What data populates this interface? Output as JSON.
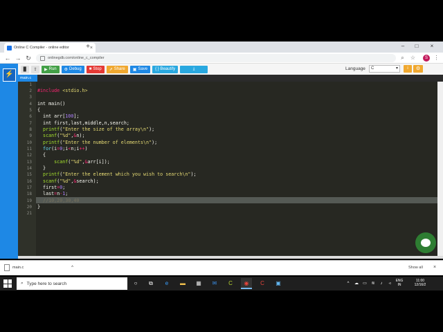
{
  "browser": {
    "tab_title": "Online C Compiler - online editor",
    "url": "onlinegdb.com/online_c_compiler",
    "profile_initial": "S"
  },
  "toolbar": {
    "run_label": "Run",
    "debug_label": "Debug",
    "stop_label": "Stop",
    "share_label": "Share",
    "save_label": "Save",
    "beautify_label": "{ } Beautify",
    "language_label": "Language",
    "language_value": "C"
  },
  "editor": {
    "file_tab": "main.c",
    "line_numbers": [
      "1",
      "2",
      "3",
      "4",
      "5",
      "6",
      "7",
      "8",
      "9",
      "10",
      "11",
      "12",
      "13",
      "14",
      "15",
      "16",
      "17",
      "18",
      "19",
      "20",
      "21"
    ]
  },
  "downloads": {
    "file_name": "main.c",
    "show_all": "Show all"
  },
  "taskbar": {
    "search_placeholder": "Type here to search",
    "language_line1": "ENG",
    "language_line2": "IN",
    "time": "11:00",
    "date": "12/16/2"
  },
  "colors": {
    "accent": "#1e88e5",
    "run": "#43a047",
    "debug": "#1e88e5",
    "stop": "#e53935",
    "share": "#f0a830",
    "save": "#1e88e5",
    "beautify": "#29a8e0"
  }
}
